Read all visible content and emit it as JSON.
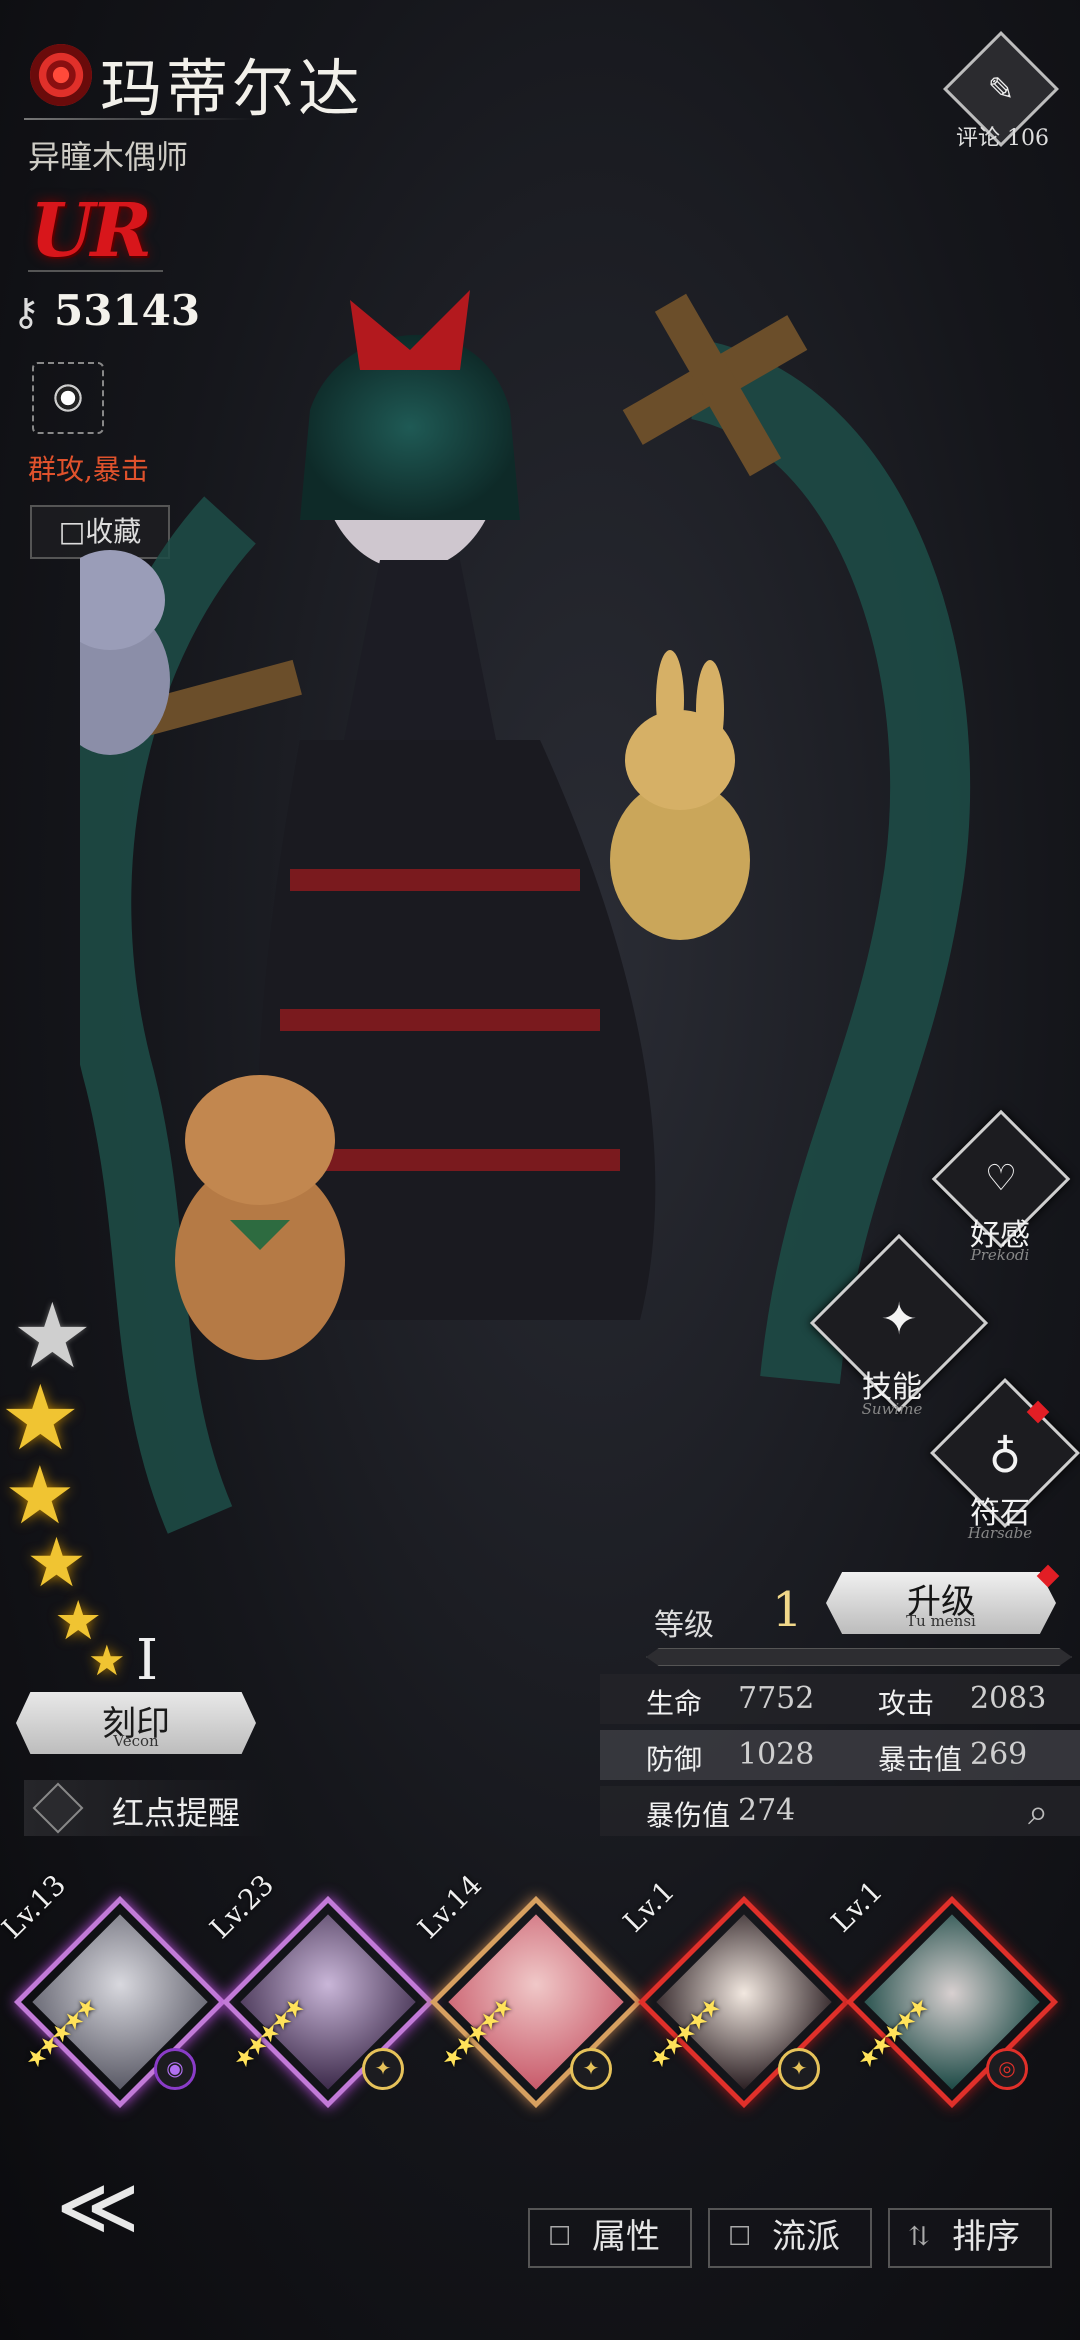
{
  "header": {
    "name": "玛蒂尔达",
    "title": "异瞳木偶师",
    "rarity": "UR",
    "power": "53143",
    "tags": "群攻,暴击",
    "favorite_label": "□收藏"
  },
  "comment": {
    "label": "评论 106"
  },
  "side_buttons": {
    "affection": {
      "label": "好感",
      "sub": "Prekodi"
    },
    "skill": {
      "label": "技能",
      "sub": "Suwime"
    },
    "rune": {
      "label": "符石",
      "sub": "Harsabe"
    }
  },
  "stars": {
    "filled": 5,
    "max": 6,
    "count_label": "I"
  },
  "engrave": {
    "label": "刻印",
    "sub": "Vecon"
  },
  "red_dot_label": "红点提醒",
  "level": {
    "label": "等级",
    "value": "1",
    "upgrade_label": "升级",
    "upgrade_sub": "Tu mensi"
  },
  "stats": [
    {
      "k1": "生命",
      "v1": "7752",
      "k2": "攻击",
      "v2": "2083"
    },
    {
      "k1": "防御",
      "v1": "1028",
      "k2": "暴击值",
      "v2": "269"
    },
    {
      "k1": "暴伤值",
      "v1": "274",
      "k2": "",
      "v2": ""
    }
  ],
  "roster": [
    {
      "level": "Lv.13",
      "stars": "★★★★★",
      "badge": "◉",
      "frame_color": "#c27ad8"
    },
    {
      "level": "Lv.23",
      "stars": "★★★★★",
      "badge": "✦",
      "frame_color": "#c27ad8"
    },
    {
      "level": "Lv.14",
      "stars": "★★★★★",
      "badge": "✦",
      "frame_color": "#d7a060"
    },
    {
      "level": "Lv.1",
      "stars": "★★★★★",
      "badge": "✦",
      "frame_color": "#e0302a"
    },
    {
      "level": "Lv.1",
      "stars": "★★★★★",
      "badge": "◎",
      "frame_color": "#e0302a"
    }
  ],
  "bottom": {
    "attr_label": "属性",
    "school_label": "流派",
    "sort_label": "排序"
  },
  "colors": {
    "accent_red": "#d8161b",
    "gold": "#f0c432"
  }
}
